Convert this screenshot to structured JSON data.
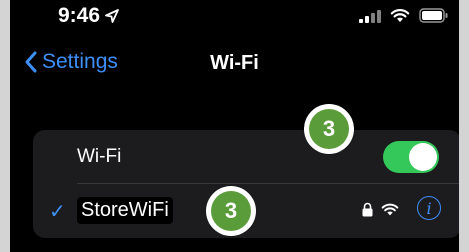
{
  "status_bar": {
    "time": "9:46",
    "icons": [
      "location-arrow-icon",
      "cellular-signal-icon",
      "wifi-icon",
      "battery-icon"
    ]
  },
  "nav": {
    "back_label": "Settings",
    "title": "Wi-Fi"
  },
  "wifi_toggle": {
    "label": "Wi-Fi",
    "on": true,
    "color": "#34c759"
  },
  "current_network": {
    "name": "StoreWiFi",
    "selected": true,
    "icons": [
      "lock-icon",
      "wifi-strength-icon",
      "info-icon"
    ]
  },
  "callouts": [
    {
      "number": "3",
      "color": "#5b9c3a"
    },
    {
      "number": "3",
      "color": "#5b9c3a"
    }
  ],
  "colors": {
    "accent": "#3e8ef7",
    "background": "#000000",
    "card": "#1c1c1e"
  }
}
